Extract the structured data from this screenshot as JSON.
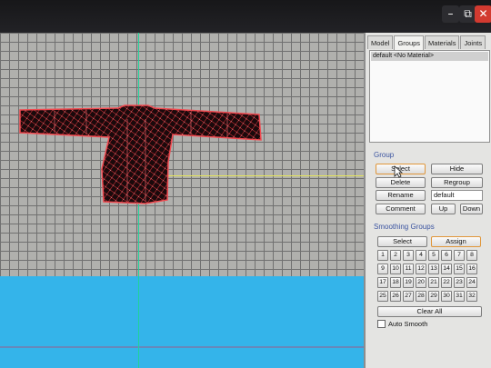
{
  "window": {
    "minimize_icon": "minimize-icon",
    "maximize_icon": "maximize-icon",
    "close_icon": "close-icon",
    "min_glyph": "–",
    "max_glyph": "⧉",
    "close_glyph": "✕",
    "close_color": "#d23a30"
  },
  "viewport": {
    "model": "sweater-wireframe",
    "wire_color": "#e8323a",
    "grid_color": "#707070",
    "floor_color": "#34b4ea"
  },
  "panel": {
    "tabs": [
      {
        "label": "Model",
        "active": false
      },
      {
        "label": "Groups",
        "active": true
      },
      {
        "label": "Materials",
        "active": false
      },
      {
        "label": "Joints",
        "active": false
      }
    ],
    "group_list": [
      "default <No Material>"
    ],
    "group_section_label": "Group",
    "buttons": {
      "select": "Select",
      "hide": "Hide",
      "delete": "Delete",
      "regroup": "Regroup",
      "rename": "Rename",
      "comment": "Comment",
      "up": "Up",
      "down": "Down"
    },
    "group_name_value": "default",
    "smoothing_section_label": "Smoothing Groups",
    "smoothing_buttons": {
      "select": "Select",
      "assign": "Assign",
      "clear_all": "Clear All"
    },
    "smoothing_numbers": [
      "1",
      "2",
      "3",
      "4",
      "5",
      "6",
      "7",
      "8",
      "9",
      "10",
      "11",
      "12",
      "13",
      "14",
      "15",
      "16",
      "17",
      "18",
      "19",
      "20",
      "21",
      "22",
      "23",
      "24",
      "25",
      "26",
      "27",
      "28",
      "29",
      "30",
      "31",
      "32"
    ],
    "auto_smooth_label": "Auto Smooth",
    "auto_smooth_checked": false
  }
}
